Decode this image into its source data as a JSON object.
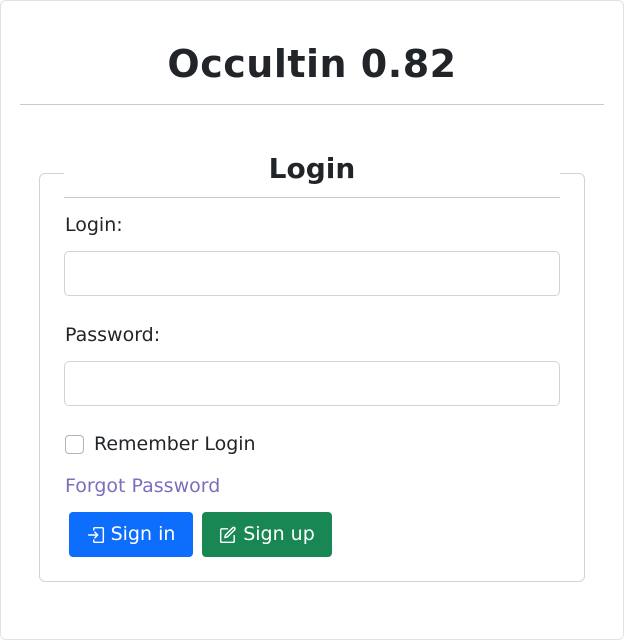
{
  "app": {
    "title": "Occultin 0.82"
  },
  "form": {
    "legend": "Login",
    "login_label": "Login:",
    "login_value": "",
    "password_label": "Password:",
    "password_value": "",
    "remember_label": "Remember Login",
    "remember_checked": false,
    "forgot_link": "Forgot Password",
    "signin_label": "Sign in",
    "signup_label": "Sign up",
    "signin_icon": "box-arrow-in-right-icon",
    "signup_icon": "pencil-square-icon"
  },
  "colors": {
    "primary": "#0d6efd",
    "success": "#198754",
    "link": "#7a6fbf"
  }
}
